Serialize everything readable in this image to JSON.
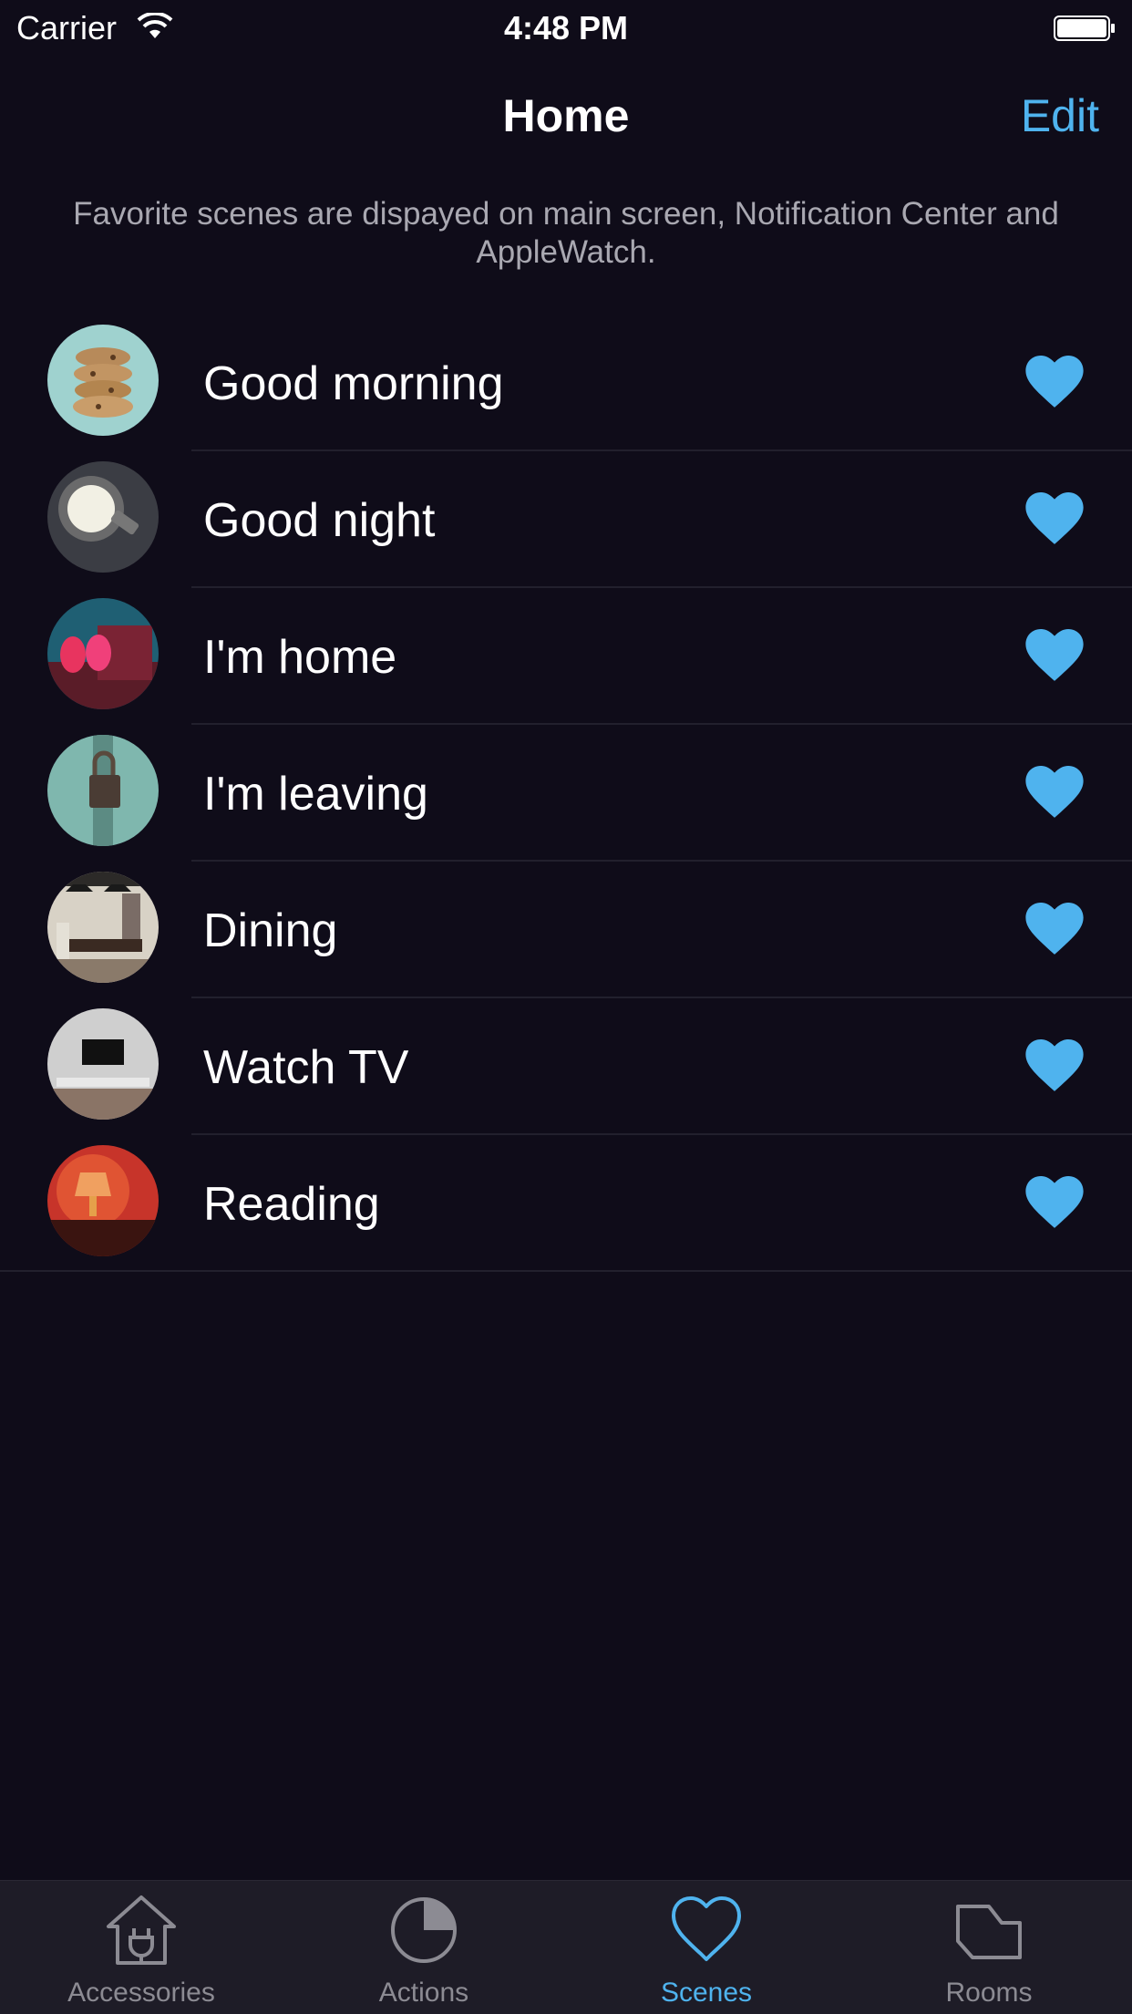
{
  "status_bar": {
    "carrier": "Carrier",
    "time": "4:48 PM"
  },
  "nav": {
    "title": "Home",
    "edit_label": "Edit"
  },
  "info": "Favorite scenes are dispayed on main screen, Notification Center and AppleWatch.",
  "scenes": [
    {
      "name": "Good morning",
      "favorite": true
    },
    {
      "name": "Good night",
      "favorite": true
    },
    {
      "name": "I'm home",
      "favorite": true
    },
    {
      "name": "I'm leaving",
      "favorite": true
    },
    {
      "name": "Dining",
      "favorite": true
    },
    {
      "name": "Watch TV",
      "favorite": true
    },
    {
      "name": "Reading",
      "favorite": true
    }
  ],
  "tabs": [
    {
      "label": "Accessories",
      "icon": "house-plug-icon",
      "active": false
    },
    {
      "label": "Actions",
      "icon": "pie-icon",
      "active": false
    },
    {
      "label": "Scenes",
      "icon": "heart-outline-icon",
      "active": true
    },
    {
      "label": "Rooms",
      "icon": "room-icon",
      "active": false
    }
  ],
  "colors": {
    "accent": "#4fb3ee",
    "background": "#0f0c19",
    "tab_bar": "#1e1c27"
  }
}
